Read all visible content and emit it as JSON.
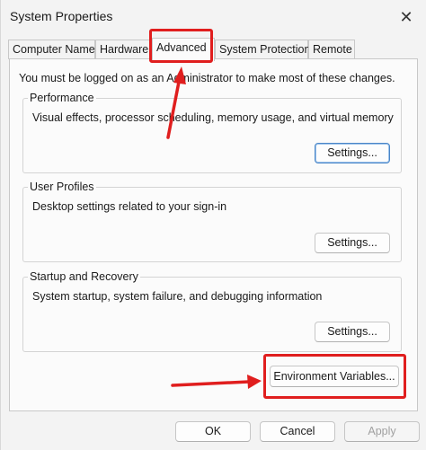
{
  "window": {
    "title": "System Properties",
    "close_glyph": "✕",
    "close_icon": "close-icon"
  },
  "tabs": [
    {
      "label": "Computer Name",
      "active": false
    },
    {
      "label": "Hardware",
      "active": false
    },
    {
      "label": "Advanced",
      "active": true
    },
    {
      "label": "System Protection",
      "active": false
    },
    {
      "label": "Remote",
      "active": false
    }
  ],
  "advanced": {
    "admin_note": "You must be logged on as an Administrator to make most of these changes.",
    "performance": {
      "title": "Performance",
      "description": "Visual effects, processor scheduling, memory usage, and virtual memory",
      "button": "Settings..."
    },
    "user_profiles": {
      "title": "User Profiles",
      "description": "Desktop settings related to your sign-in",
      "button": "Settings..."
    },
    "startup_recovery": {
      "title": "Startup and Recovery",
      "description": "System startup, system failure, and debugging information",
      "button": "Settings..."
    },
    "env_button": "Environment Variables..."
  },
  "footer": {
    "ok": "OK",
    "cancel": "Cancel",
    "apply": "Apply"
  },
  "colors": {
    "annotation_red": "#e01e1e",
    "focus_blue": "#4a86c8"
  }
}
